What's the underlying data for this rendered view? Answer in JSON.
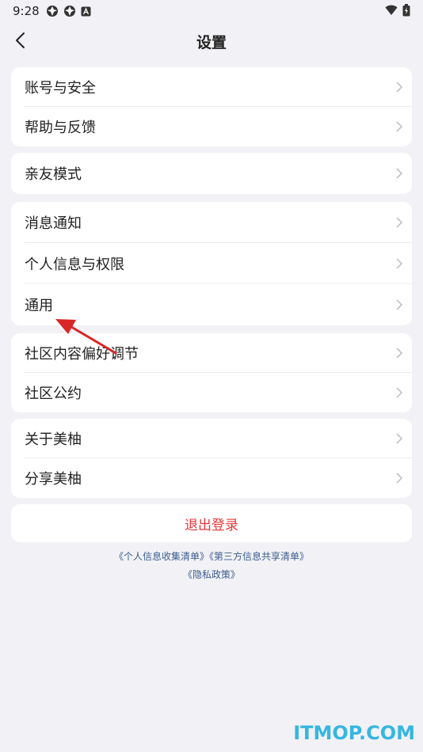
{
  "status_bar": {
    "time": "9:28",
    "icons_left": [
      "app-icon-a",
      "app-icon-b",
      "font-icon"
    ],
    "icons_right": [
      "wifi-icon",
      "battery-icon"
    ]
  },
  "header": {
    "title": "设置"
  },
  "groups": [
    {
      "items": [
        {
          "label": "账号与安全"
        },
        {
          "label": "帮助与反馈"
        }
      ]
    },
    {
      "items": [
        {
          "label": "亲友模式"
        }
      ]
    },
    {
      "items": [
        {
          "label": "消息通知"
        },
        {
          "label": "个人信息与权限"
        },
        {
          "label": "通用"
        }
      ]
    },
    {
      "items": [
        {
          "label": "社区内容偏好调节"
        },
        {
          "label": "社区公约"
        }
      ]
    },
    {
      "items": [
        {
          "label": "关于美柚"
        },
        {
          "label": "分享美柚"
        }
      ]
    }
  ],
  "logout_label": "退出登录",
  "policies": {
    "personal_info_list": "《个人信息收集清单》",
    "third_party_list": "《第三方信息共享清单》",
    "privacy_policy": "《隐私政策》"
  },
  "annotation": {
    "arrow_color": "#d92626",
    "points_to": "通用"
  },
  "watermark": "ITMOP.COM",
  "colors": {
    "background": "#f2f2f6",
    "card": "#ffffff",
    "logout": "#e8373a",
    "link": "#3b5c8f",
    "watermark": "#36b6e0"
  }
}
